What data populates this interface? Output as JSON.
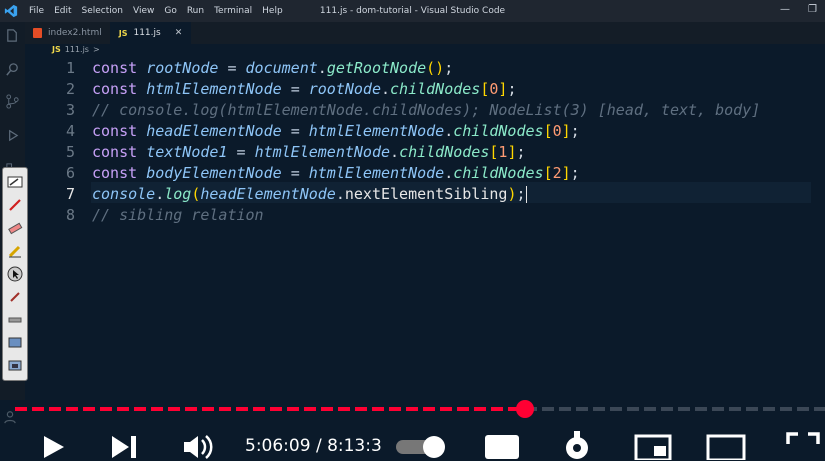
{
  "titlebar": {
    "menu": [
      "File",
      "Edit",
      "Selection",
      "View",
      "Go",
      "Run",
      "Terminal",
      "Help"
    ],
    "title": "111.js - dom-tutorial - Visual Studio Code"
  },
  "tabs": [
    {
      "label": "index2.html",
      "icon": "html-file-icon",
      "active": false
    },
    {
      "label": "111.js",
      "icon": "js-file-icon",
      "active": true
    }
  ],
  "breadcrumb": {
    "file": "111.js",
    "sep": ">",
    "js": "JS"
  },
  "editor": {
    "current_line": 7,
    "lines": [
      {
        "n": "1",
        "text": "const rootNode = document.getRootNode();"
      },
      {
        "n": "2",
        "text": "const htmlElementNode = rootNode.childNodes[0];"
      },
      {
        "n": "3",
        "text": "// console.log(htmlElementNode.childNodes); NodeList(3) [head, text, body]"
      },
      {
        "n": "4",
        "text": "const headElementNode = htmlElementNode.childNodes[0];"
      },
      {
        "n": "5",
        "text": "const textNode1 = htmlElementNode.childNodes[1];"
      },
      {
        "n": "6",
        "text": "const bodyElementNode = htmlElementNode.childNodes[2];"
      },
      {
        "n": "7",
        "text": "console.log(headElementNode.nextElementSibling);"
      },
      {
        "n": "8",
        "text": "// sibling relation"
      }
    ]
  },
  "player": {
    "time": "5:06:09 / 8:13:3",
    "progress": 0.62,
    "accent": "#ff0033"
  },
  "colors": {
    "background": "#0b1a2a",
    "keyword": "#c6a0f6",
    "comment": "#5f6f80"
  }
}
